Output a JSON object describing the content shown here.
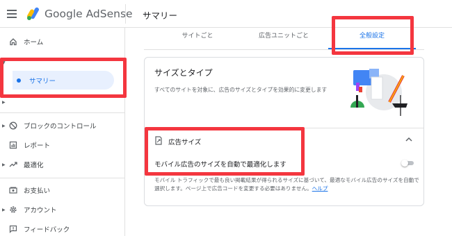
{
  "header": {
    "brand": "Google AdSense",
    "page_title": "サマリー"
  },
  "sidebar": {
    "items": [
      {
        "label": "ホーム",
        "icon": "home-icon"
      },
      {
        "label": "サマリー",
        "icon": "dot-icon"
      },
      {
        "label": "ブロックのコントロール",
        "icon": "block-icon"
      },
      {
        "label": "レポート",
        "icon": "report-icon"
      },
      {
        "label": "最適化",
        "icon": "trending-icon"
      },
      {
        "label": "お支払い",
        "icon": "payments-icon"
      },
      {
        "label": "アカウント",
        "icon": "gear-icon"
      },
      {
        "label": "フィードバック",
        "icon": "feedback-icon"
      }
    ]
  },
  "tabs": [
    {
      "label": "サイトごと"
    },
    {
      "label": "広告ユニットごと"
    },
    {
      "label": "全般設定"
    }
  ],
  "card": {
    "title": "サイズとタイプ",
    "description": "すべてのサイトを対象に、広告のサイズとタイプを効果的に変更します",
    "section_title": "広告サイズ",
    "setting_label": "モバイル広告のサイズを自動で最適化します",
    "setting_description": "モバイル トラフィックで最も良い掲載結果が得られるサイズに基づいて、最適なモバイル広告のサイズを自動で選択します。ページ上で広告コードを変更する必要はありません。",
    "help_link": "ヘルプ",
    "toggle_on": false
  },
  "colors": {
    "accent": "#1a73e8",
    "highlight": "#f4363f",
    "selected_bg": "#e8f0fe"
  }
}
